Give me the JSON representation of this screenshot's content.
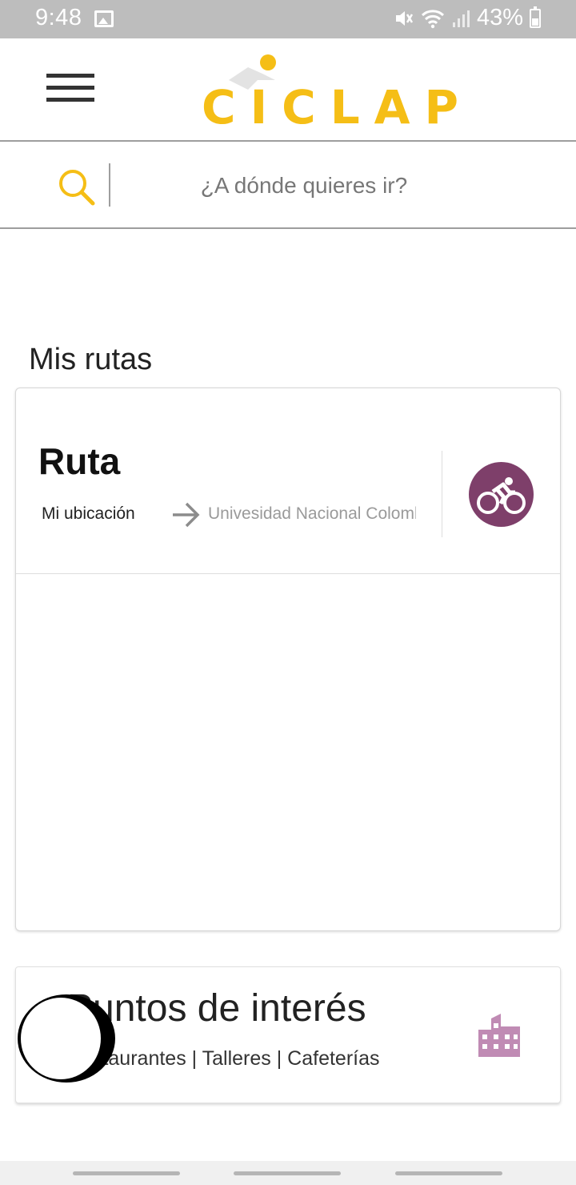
{
  "status_bar": {
    "time": "9:48",
    "battery": "43%",
    "icons": [
      "image-icon",
      "mute-icon",
      "wifi-icon",
      "signal-icon",
      "battery-icon"
    ]
  },
  "app_bar": {
    "logo_text": "CICLAP",
    "menu_icon": "hamburger-icon"
  },
  "search": {
    "placeholder": "¿A dónde quieres ir?",
    "icon": "search-icon"
  },
  "my_routes": {
    "section_title": "Mis rutas",
    "card": {
      "title": "Ruta",
      "from": "Mi ubicación",
      "to": "Univesidad Nacional Colombia",
      "mode_icon": "bicycle-icon"
    }
  },
  "points_of_interest": {
    "title": "Puntos de interés",
    "subtitle": "Restaurantes | Talleres | Cafeterías",
    "icon": "building-icon"
  },
  "colors": {
    "brand": "#f5be16",
    "accent": "#7e3f6a",
    "poi_icon": "#c08bb4"
  }
}
